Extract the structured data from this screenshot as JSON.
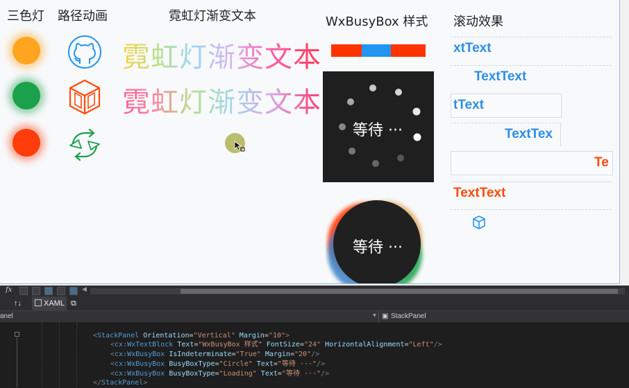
{
  "headers": {
    "traffic_light": "三色灯",
    "path_animation": "路径动画",
    "neon_text": "霓虹灯渐变文本",
    "busybox_style": "WxBusyBox 样式",
    "scroll_effect": "滚动效果"
  },
  "neon": {
    "line1": "霓虹灯渐变文本",
    "line2": "霓虹灯渐变文本"
  },
  "busybox": {
    "circle_text": "等待 ···",
    "loading_text": "等待 ···",
    "bar_colors": [
      "#ff3300",
      "#2196f3",
      "#ff3300"
    ]
  },
  "scroll": {
    "rows": [
      {
        "text": "xtText",
        "color": "#2b8ee8"
      },
      {
        "text": "TextText",
        "color": "#2b8ee8"
      },
      {
        "text": "tText",
        "color": "#2b8ee8"
      },
      {
        "text": "TextTex",
        "color": "#2b8ee8"
      },
      {
        "text": "Te",
        "color": "#ff4a0a"
      },
      {
        "text": "TextText",
        "color": "#ff4a0a"
      }
    ]
  },
  "lights": {
    "colors": [
      "#ffa520",
      "#1ba04b",
      "#ff3c0a"
    ]
  },
  "bottom": {
    "xaml_tab": "XAML",
    "nav_left": "anel",
    "nav_right": "StackPanel",
    "swap_label": "↑↓",
    "fx_label": "fx"
  },
  "code": {
    "line1": {
      "open": "<",
      "tag": "StackPanel",
      "a1": "Orientation",
      "v1": "\"Vertical\"",
      "a2": "Margin",
      "v2": "\"10\"",
      "close": ">"
    },
    "line2": {
      "open": "<",
      "prefix": "cx:",
      "tag": "WxTextBlock",
      "a1": "Text",
      "v1": "\"WxBusyBox 样式\"",
      "a2": "FontSize",
      "v2": "\"24\"",
      "a3": "HorizontalAlignment",
      "v3": "\"Left\"",
      "close": "/>"
    },
    "line3": {
      "open": "<",
      "prefix": "cx:",
      "tag": "WxBusyBox",
      "a1": "IsIndeterminate",
      "v1": "\"True\"",
      "a2": "Margin",
      "v2": "\"20\"",
      "close": "/>"
    },
    "line4": {
      "open": "<",
      "prefix": "cx:",
      "tag": "WxBusyBox",
      "a1": "BusyBoxType",
      "v1": "\"Circle\"",
      "a2": "Text",
      "v2": "\"等待 ···\"",
      "close": "/>"
    },
    "line5": {
      "open": "<",
      "prefix": "cx:",
      "tag": "WxBusyBox",
      "a1": "BusyBoxType",
      "v1": "\"Loading\"",
      "a2": "Text",
      "v2": "\"等待 ···\"",
      "close": "/>"
    },
    "line6": {
      "open": "</",
      "tag": "StackPanel",
      "close": ">"
    }
  }
}
